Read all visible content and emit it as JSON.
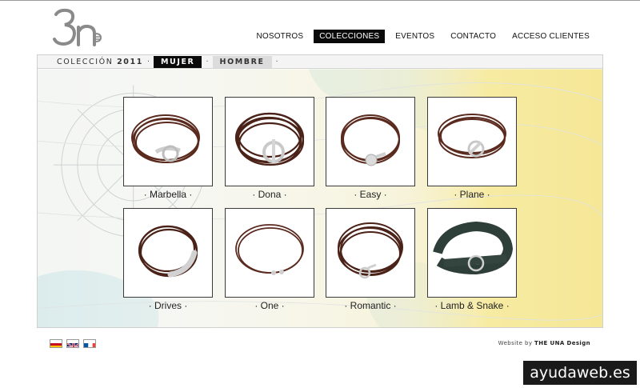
{
  "brand": {
    "logo_text": "3n"
  },
  "nav": {
    "items": [
      {
        "label": "NOSOTROS"
      },
      {
        "label": "COLECCIONES",
        "active": true
      },
      {
        "label": "EVENTOS"
      },
      {
        "label": "CONTACTO"
      },
      {
        "label": "ACCESO CLIENTES"
      }
    ]
  },
  "subnav": {
    "collection_label": "COLECCIÓN",
    "collection_year": "2011",
    "separator": "·",
    "tabs": [
      {
        "label": "MUJER",
        "active": true
      },
      {
        "label": "HOMBRE",
        "active": false
      }
    ]
  },
  "products": [
    {
      "caption": "· Marbella ·",
      "leather": "#5a2a1e",
      "icon": "bracelet-icon"
    },
    {
      "caption": "· Dona ·",
      "leather": "#4a2218",
      "icon": "bracelet-icon"
    },
    {
      "caption": "· Easy ·",
      "leather": "#5a2a1e",
      "icon": "bracelet-icon"
    },
    {
      "caption": "· Plane ·",
      "leather": "#5a2a1e",
      "icon": "bracelet-icon"
    },
    {
      "caption": "· Drives ·",
      "leather": "#4a2218",
      "icon": "bracelet-icon"
    },
    {
      "caption": "· One ·",
      "leather": "#5a2a1e",
      "icon": "bracelet-icon"
    },
    {
      "caption": "· Romantic ·",
      "leather": "#4a2218",
      "icon": "bracelet-icon"
    },
    {
      "caption": "· Lamb & Snake ·",
      "leather": "#2e3e38",
      "icon": "bracelet-icon"
    }
  ],
  "footer": {
    "flags": [
      {
        "name": "spain-flag-icon",
        "label": "Español"
      },
      {
        "name": "uk-flag-icon",
        "label": "English"
      },
      {
        "name": "france-flag-icon",
        "label": "Français"
      }
    ],
    "credit_prefix": "Website by",
    "credit_name": "THE UNA Design"
  },
  "watermark": "ayudaweb.es",
  "colors": {
    "nav_active_bg": "#0a0a0a",
    "map_sea": "#cfe5e6",
    "map_land": "#f7eba2",
    "silver": "#c8c8c8"
  }
}
